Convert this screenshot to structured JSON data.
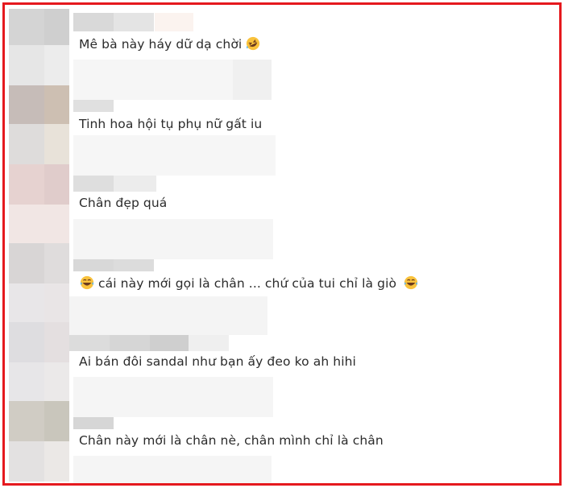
{
  "comments": [
    {
      "text": "Mê bà này háy dữ dạ chời",
      "trailing_emoji": "rofl-icon"
    },
    {
      "text": "Tinh hoa hội tụ phụ nữ gất iu"
    },
    {
      "text": "Chân đẹp quá"
    },
    {
      "text": "cái này mới gọi là chân ... chứ của tui chỉ là giò",
      "leading_emoji": "laughing-tears-icon",
      "trailing_emoji": "laughing-tears-icon"
    },
    {
      "text": "Ai bán đôi sandal như bạn ấy đeo ko ah hihi"
    },
    {
      "text": "Chân này mới là chân nè, chân mình chỉ là chân"
    }
  ],
  "colors": {
    "frame_border": "#e5191e",
    "text": "#2b2b2b",
    "emoji_yellow": "#f9c23c",
    "emoji_dark": "#6b3a1d"
  }
}
